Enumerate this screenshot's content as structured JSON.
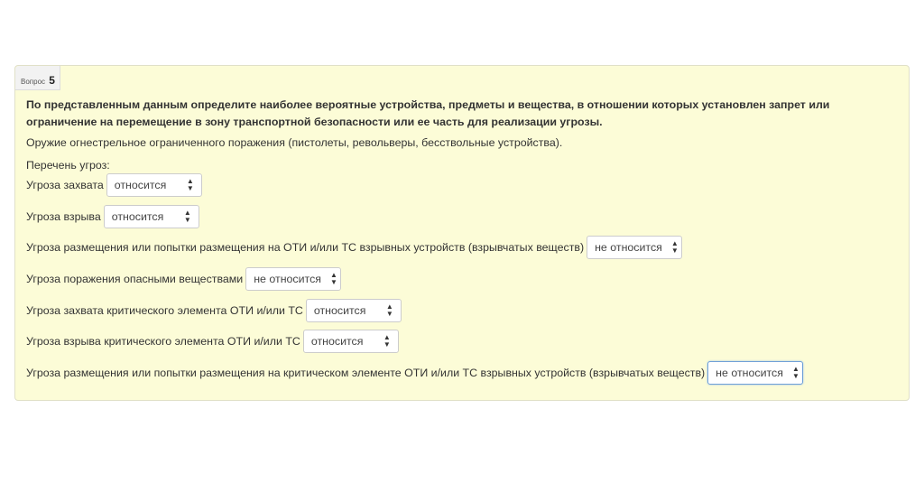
{
  "question": {
    "header_label": "Вопрос",
    "number": "5",
    "title": "По представленным данным определите наиболее вероятные устройства, предметы и вещества, в отношении которых установлен запрет или ограничение на перемещение в зону транспортной безопасности или ее часть для реализации угрозы.",
    "text": "Оружие огнестрельное ограниченного поражения (пистолеты, револьверы, бесствольные устройства).",
    "list_label": "Перечень угроз:",
    "rows": [
      {
        "label": "Угроза захвата",
        "value": "относится"
      },
      {
        "label": "Угроза взрыва",
        "value": "относится"
      },
      {
        "label": "Угроза размещения или попытки размещения на ОТИ и/или ТС взрывных устройств (взрывчатых веществ)",
        "value": "не относится"
      },
      {
        "label": "Угроза поражения опасными веществами",
        "value": "не относится"
      },
      {
        "label": "Угроза захвата критического элемента ОТИ и/или ТС",
        "value": "относится"
      },
      {
        "label": "Угроза взрыва критического элемента ОТИ и/или ТС",
        "value": "относится"
      },
      {
        "label": "Угроза размещения или попытки размещения на критическом элементе ОТИ и/или ТС взрывных устройств (взрывчатых веществ)",
        "value": "не относится"
      }
    ]
  },
  "icons": {
    "select_caret": "updown-caret-icon"
  },
  "colors": {
    "card_background": "#fcfcd7",
    "focus_border": "#6fa0d8"
  }
}
